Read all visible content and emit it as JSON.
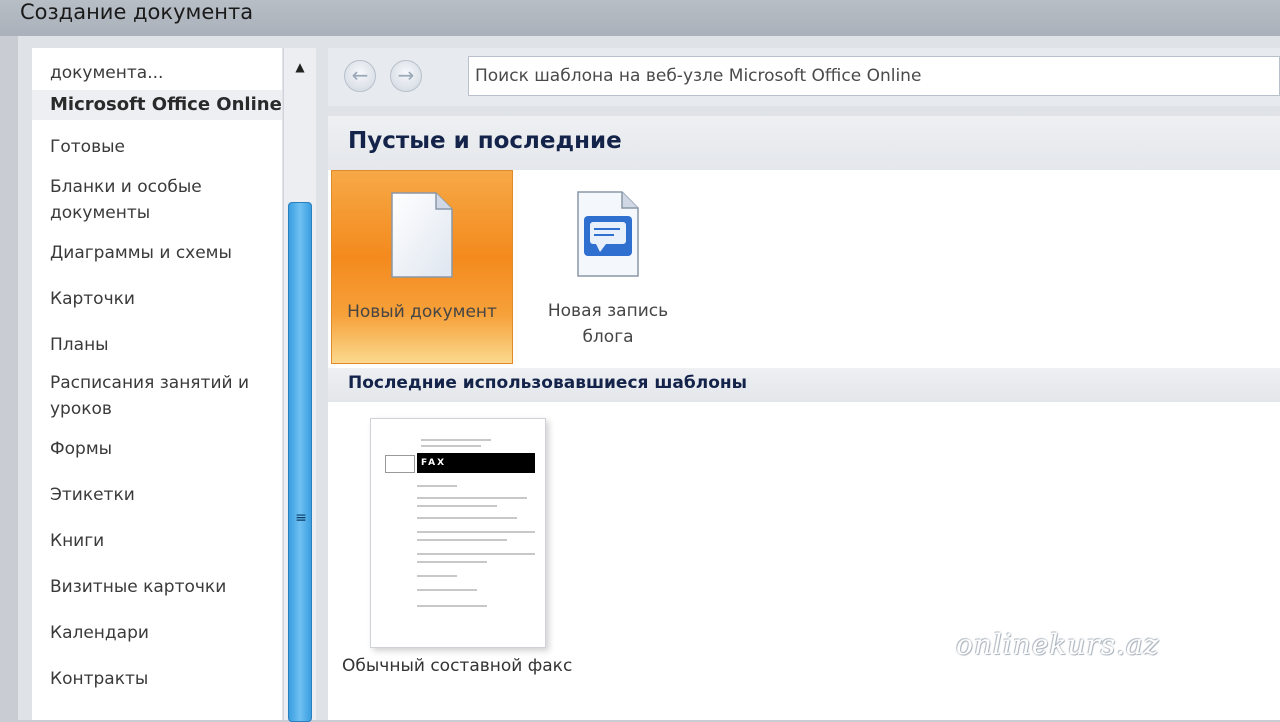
{
  "window": {
    "title": "Создание документа"
  },
  "sidebar": {
    "partial_item": "документа...",
    "section": "Microsoft Office Online",
    "items": [
      "Готовые",
      "Бланки и особые документы",
      "Диаграммы и схемы",
      "Карточки",
      "Планы",
      "Расписания занятий и уроков",
      "Формы",
      "Этикетки",
      "Книги",
      "Визитные карточки",
      "Календари",
      "Контракты"
    ]
  },
  "toolbar": {
    "search_placeholder": "Поиск шаблона на веб-узле Microsoft Office Online"
  },
  "main": {
    "section_blank": "Пустые и последние",
    "tiles": [
      {
        "label": "Новый документ",
        "icon": "blank-document-icon",
        "selected": true
      },
      {
        "label": "Новая запись блога",
        "icon": "blog-post-icon",
        "selected": false
      }
    ],
    "section_recent": "Последние использовавшиеся шаблоны",
    "recent_templates": [
      {
        "label": "Обычный составной факс",
        "thumb_text": "FAX"
      }
    ]
  },
  "watermark": "onlinekurs.az",
  "colors": {
    "accent_selected": "#f48a1d",
    "scroll_thumb": "#3b9fe0",
    "heading": "#13234a"
  }
}
